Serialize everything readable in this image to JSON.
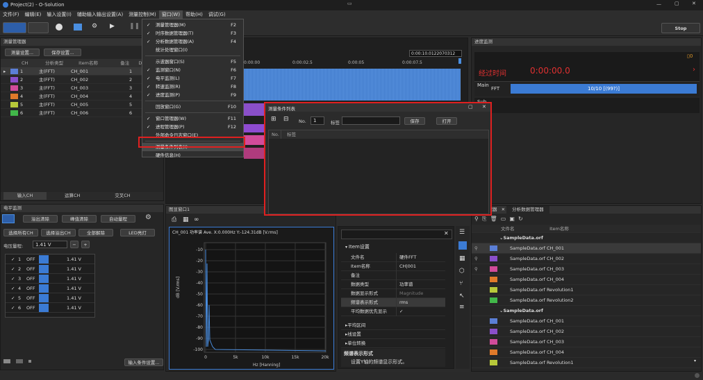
{
  "window": {
    "title": "Project(2) - O-Solution",
    "stop": "Stop"
  },
  "menubar": [
    "文件(F)",
    "编辑(E)",
    "输入设置(I)",
    "辅助输入输出设置(A)",
    "测量控制(M)",
    "窗口(W)",
    "帮助(H)",
    "调试(G)"
  ],
  "window_menu": {
    "items": [
      {
        "label": "测量管理器(M)",
        "key": "F2",
        "checked": true
      },
      {
        "label": "时序数据管理器(T)",
        "key": "F3",
        "checked": true
      },
      {
        "label": "分析数据管理器(A)",
        "key": "F4",
        "checked": true
      },
      {
        "label": "统计处理窗口(I)",
        "key": "",
        "checked": false
      },
      {
        "sep": true
      },
      {
        "label": "示波器窗口(S)",
        "key": "F5",
        "checked": false
      },
      {
        "label": "监测窗口(N)",
        "key": "F6",
        "checked": true
      },
      {
        "label": "电平监测(L)",
        "key": "F7",
        "checked": true
      },
      {
        "label": "转速监测(R)",
        "key": "F8",
        "checked": true
      },
      {
        "label": "进度监测(P)",
        "key": "F9",
        "checked": true
      },
      {
        "sep": true
      },
      {
        "label": "回放窗口(G)",
        "key": "F10",
        "checked": false
      },
      {
        "sep": true
      },
      {
        "label": "窗口管理器(W)",
        "key": "F11",
        "checked": true
      },
      {
        "label": "进程管理器(P)",
        "key": "F12",
        "checked": true
      },
      {
        "label": "外部命令日志窗口(E)",
        "key": "",
        "checked": false
      },
      {
        "sep": true
      },
      {
        "label": "测量条件列表(I)",
        "key": "",
        "checked": false,
        "highlight": true
      },
      {
        "label": "硬件信息(H)",
        "key": "",
        "checked": false
      }
    ]
  },
  "measure_mgr": {
    "title": "测量管理器",
    "btn1": "测量设置...",
    "btn2": "保存设置...",
    "cols": [
      "CH",
      "分析类型",
      "Item名称",
      "备注",
      "DO"
    ],
    "rows": [
      {
        "ch": "1",
        "type": "主(FFT)",
        "name": "CH_001",
        "do": "1",
        "color": "#5b7fd6"
      },
      {
        "ch": "2",
        "type": "主(FFT)",
        "name": "CH_002",
        "do": "2",
        "color": "#8a4fc9"
      },
      {
        "ch": "3",
        "type": "主(FFT)",
        "name": "CH_003",
        "do": "3",
        "color": "#d14b9a"
      },
      {
        "ch": "4",
        "type": "主(FFT)",
        "name": "CH_004",
        "do": "4",
        "color": "#e07a2a"
      },
      {
        "ch": "5",
        "type": "主(FFT)",
        "name": "CH_005",
        "do": "5",
        "color": "#b8c93a"
      },
      {
        "ch": "6",
        "type": "主(FFT)",
        "name": "CH_006",
        "do": "6",
        "color": "#42b84a"
      }
    ],
    "tabs": [
      "输入CH",
      "运算CH",
      "交叉CH"
    ]
  },
  "timebar": {
    "time": "0:00:10.0122070312",
    "ticks": [
      "0:00:00",
      "0:00:02.5",
      "0:00:05",
      "0:00:07.5"
    ]
  },
  "level": {
    "title": "电平监测",
    "b1": "溢出清除",
    "b2": "峰值清除",
    "b3": "自动量程",
    "b4": "选择所有CH",
    "b5": "选择溢出CH",
    "b6": "全部解除",
    "b7": "LED亮灯",
    "range_label": "电压量程:",
    "range": "1.41 V",
    "rows": [
      {
        "n": "1",
        "st": "OFF",
        "v": "1.41 V"
      },
      {
        "n": "2",
        "st": "OFF",
        "v": "1.41 V"
      },
      {
        "n": "3",
        "st": "OFF",
        "v": "1.41 V"
      },
      {
        "n": "4",
        "st": "OFF",
        "v": "1.41 V"
      },
      {
        "n": "5",
        "st": "OFF",
        "v": "1.41 V"
      },
      {
        "n": "6",
        "st": "OFF",
        "v": "1.41 V"
      }
    ],
    "bottom_btn": "输入条件设置..."
  },
  "graph": {
    "title": "图显窗口1",
    "header": "CH_001  功率谱  Ave. X:0.000Hz Y:-124.31dB [V.rms]",
    "ylabel": "dB [V.rms]",
    "xlabel": "Hz [Hanning]",
    "yticks": [
      "-10",
      "-20",
      "-30",
      "-40",
      "-50",
      "-60",
      "-70",
      "-80",
      "-90",
      "-100"
    ],
    "xticks": [
      "0",
      "5k",
      "10k",
      "15k",
      "20k"
    ]
  },
  "props": {
    "section": "Item设置",
    "rows": [
      {
        "k": "文件名",
        "v": "硬件FFT"
      },
      {
        "k": "Item名称",
        "v": "CH|001"
      },
      {
        "k": "备注",
        "v": ""
      },
      {
        "k": "数据类型",
        "v": "功率谱"
      },
      {
        "k": "数据显示形式",
        "v": "Magnitude"
      },
      {
        "k": "频谱表示形式",
        "v": "rms"
      },
      {
        "k": "平均数据优先显示",
        "v": "✓"
      }
    ],
    "groups": [
      "平均区间",
      "线设置",
      "单位转换"
    ],
    "desc_title": "频谱表示形式",
    "desc": "设置Y轴的频谱显示形式。"
  },
  "progress": {
    "title": "进度监测",
    "elapsed_label": "经过时间",
    "elapsed": "0:00:00.0",
    "main": "Main",
    "fft": "FFT",
    "count": "10/10 [(99?)]",
    "sub": "Sub",
    "page": "0"
  },
  "dialog": {
    "title": "测量条件列表",
    "no_label": "No.",
    "no_val": "1",
    "tag_label": "标签",
    "save": "保存",
    "open": "打开",
    "col1": "No.",
    "col2": "标签"
  },
  "analysis": {
    "tab1": "测量管理器",
    "tab2": "分析数据管理器",
    "col1": "文件名",
    "col2": "Item名称",
    "groups": [
      {
        "name": "SampleData.orf",
        "items": [
          {
            "text": "SampleData.orf CH_001",
            "color": "#5b7fd6"
          },
          {
            "text": "SampleData.orf CH_002",
            "color": "#8a4fc9"
          },
          {
            "text": "SampleData.orf CH_003",
            "color": "#d14b9a"
          },
          {
            "text": "SampleData.orf CH_004",
            "color": "#e07a2a"
          },
          {
            "text": "SampleData.orf Revolution1",
            "color": "#b8c93a"
          },
          {
            "text": "SampleData.orf Revolution2",
            "color": "#42b84a"
          }
        ]
      },
      {
        "name": "SampleData.orf",
        "items": [
          {
            "text": "SampleData.orf CH_001",
            "color": "#5b7fd6"
          },
          {
            "text": "SampleData.orf CH_002",
            "color": "#8a4fc9"
          },
          {
            "text": "SampleData.orf CH_003",
            "color": "#d14b9a"
          },
          {
            "text": "SampleData.orf CH_004",
            "color": "#e07a2a"
          },
          {
            "text": "SampleData.orf Revolution1",
            "color": "#b8c93a"
          }
        ]
      }
    ]
  }
}
